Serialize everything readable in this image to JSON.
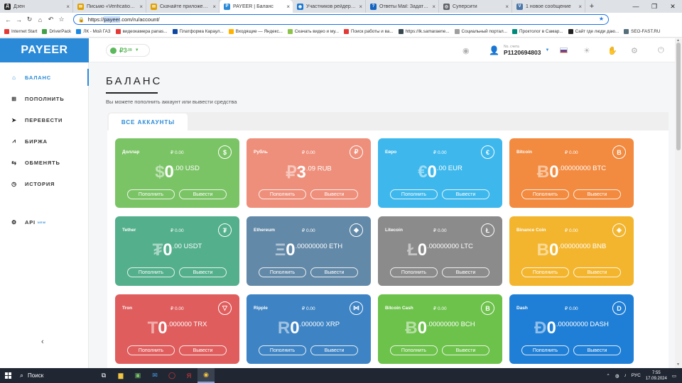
{
  "browser": {
    "tabs": [
      {
        "label": "Дзен",
        "icon": "dzen-icon",
        "color": "#222222",
        "glyph": "Д",
        "active": false
      },
      {
        "label": "Письмо «Verification Co...",
        "icon": "mail-icon",
        "color": "#e0a000",
        "glyph": "✉",
        "active": false
      },
      {
        "label": "Скачайте приложение Ya...",
        "icon": "mail-icon",
        "color": "#e0a000",
        "glyph": "✉",
        "active": false
      },
      {
        "label": "PAYEER | Баланс",
        "icon": "payeer-icon",
        "color": "#2a8ad8",
        "glyph": "P",
        "active": true
      },
      {
        "label": "Участников рейдерской...",
        "icon": "site-icon",
        "color": "#1976d2",
        "glyph": "◉",
        "active": false
      },
      {
        "label": "Ответы Mail: Задать воп...",
        "icon": "answers-icon",
        "color": "#1565c0",
        "glyph": "?",
        "active": false
      },
      {
        "label": "Суперсити",
        "icon": "globe-icon",
        "color": "#5f6368",
        "glyph": "◎",
        "active": false
      },
      {
        "label": "1 новое сообщение",
        "icon": "vk-icon",
        "color": "#4a76a8",
        "glyph": "V",
        "active": false
      }
    ],
    "url_prefix": "https://",
    "url_domain": "payeer",
    "url_rest": ".com/ru/account/",
    "bookmarks": [
      {
        "label": "Internet Start",
        "color": "#e53935"
      },
      {
        "label": "DriverPack",
        "color": "#43a047"
      },
      {
        "label": "ЛК - Мой ГАЗ",
        "color": "#1e88e5"
      },
      {
        "label": "видеокамера panas...",
        "color": "#e53935"
      },
      {
        "label": "Платформа Караул...",
        "color": "#0d47a1"
      },
      {
        "label": "Входящие — Яндекс...",
        "color": "#ffb300"
      },
      {
        "label": "Скачать видео и му...",
        "color": "#8bc34a"
      },
      {
        "label": "Поиск работы и ва...",
        "color": "#e53935"
      },
      {
        "label": "https://lk.samaraene...",
        "color": "#37474f"
      },
      {
        "label": "Социальный портал...",
        "color": "#9e9e9e"
      },
      {
        "label": "Проктолог в Самар...",
        "color": "#00897b"
      },
      {
        "label": "Сайт где люди даю...",
        "color": "#212121"
      },
      {
        "label": "SEO-FAST.RU",
        "color": "#546e7a"
      }
    ]
  },
  "sidebar": {
    "logo": "PAYEER",
    "items": [
      {
        "label": "БАЛАНС",
        "icon": "home-icon",
        "glyph": "⌂",
        "active": true
      },
      {
        "label": "ПОПОЛНИТЬ",
        "icon": "plus-square-icon",
        "glyph": "⊞",
        "active": false
      },
      {
        "label": "ПЕРЕВЕСТИ",
        "icon": "paper-plane-icon",
        "glyph": "➤",
        "active": false
      },
      {
        "label": "БИРЖА",
        "icon": "chart-icon",
        "glyph": "⩘",
        "active": false
      },
      {
        "label": "ОБМЕНЯТЬ",
        "icon": "exchange-icon",
        "glyph": "⇆",
        "active": false
      },
      {
        "label": "ИСТОРИЯ",
        "icon": "clock-icon",
        "glyph": "◷",
        "active": false
      }
    ],
    "api": {
      "label": "API",
      "badge": "NEW"
    }
  },
  "header": {
    "balance_int": "₽3",
    "balance_frac": ".09",
    "user_label": "No. счета",
    "account_id": "P1120694803"
  },
  "main": {
    "title": "БАЛАНС",
    "subtitle": "Вы можете пополнить аккаунт или вывести средства",
    "tab": "ВСЕ АККАУНТЫ",
    "topup_label": "Пополнить",
    "withdraw_label": "Вывести",
    "cards": [
      {
        "name": "Доллар",
        "rub": "₽ 0.00",
        "symbol": "$",
        "int": "0",
        "frac": ".00 USD",
        "icon": "dollar-icon",
        "glyph": "$",
        "color": "#7bc466"
      },
      {
        "name": "Рубль",
        "rub": "₽ 0.00",
        "symbol": "₽",
        "int": "3",
        "frac": ".09 RUB",
        "icon": "ruble-icon",
        "glyph": "₽",
        "color": "#ee8f7b"
      },
      {
        "name": "Евро",
        "rub": "₽ 0.00",
        "symbol": "€",
        "int": "0",
        "frac": ".00 EUR",
        "icon": "euro-icon",
        "glyph": "€",
        "color": "#3eb8ec"
      },
      {
        "name": "Bitcoin",
        "rub": "₽ 0.00",
        "symbol": "Ƀ",
        "int": "0",
        "frac": ".00000000 BTC",
        "icon": "bitcoin-icon",
        "glyph": "B",
        "color": "#f28a3f"
      },
      {
        "name": "Tether",
        "rub": "₽ 0.00",
        "symbol": "₮",
        "int": "0",
        "frac": ".00 USDT",
        "icon": "tether-icon",
        "glyph": "₮",
        "color": "#53af8c"
      },
      {
        "name": "Ethereum",
        "rub": "₽ 0.00",
        "symbol": "Ξ",
        "int": "0",
        "frac": ".00000000 ETH",
        "icon": "ethereum-icon",
        "glyph": "◆",
        "color": "#6389a8"
      },
      {
        "name": "Litecoin",
        "rub": "₽ 0.00",
        "symbol": "Ł",
        "int": "0",
        "frac": ".00000000 LTC",
        "icon": "litecoin-icon",
        "glyph": "Ł",
        "color": "#8b8b8b"
      },
      {
        "name": "Binance Coin",
        "rub": "₽ 0.00",
        "symbol": "B",
        "int": "0",
        "frac": ".00000000 BNB",
        "icon": "binance-icon",
        "glyph": "◈",
        "color": "#f3b52e"
      },
      {
        "name": "Tron",
        "rub": "₽ 0.00",
        "symbol": "T",
        "int": "0",
        "frac": ".000000 TRX",
        "icon": "tron-icon",
        "glyph": "▽",
        "color": "#e05d5d"
      },
      {
        "name": "Ripple",
        "rub": "₽ 0.00",
        "symbol": "R",
        "int": "0",
        "frac": ".000000 XRP",
        "icon": "ripple-icon",
        "glyph": "⋈",
        "color": "#3e84c4"
      },
      {
        "name": "Bitcoin Cash",
        "rub": "₽ 0.00",
        "symbol": "Ƀ",
        "int": "0",
        "frac": ".00000000 BCH",
        "icon": "bitcoin-cash-icon",
        "glyph": "B",
        "color": "#6cc24a"
      },
      {
        "name": "Dash",
        "rub": "₽ 0.00",
        "symbol": "Đ",
        "int": "0",
        "frac": ".00000000 DASH",
        "icon": "dash-icon",
        "glyph": "D",
        "color": "#1f7fd6"
      }
    ]
  },
  "taskbar": {
    "search": "Поиск",
    "lang": "РУС",
    "time": "7:55",
    "date": "17.09.2024"
  }
}
